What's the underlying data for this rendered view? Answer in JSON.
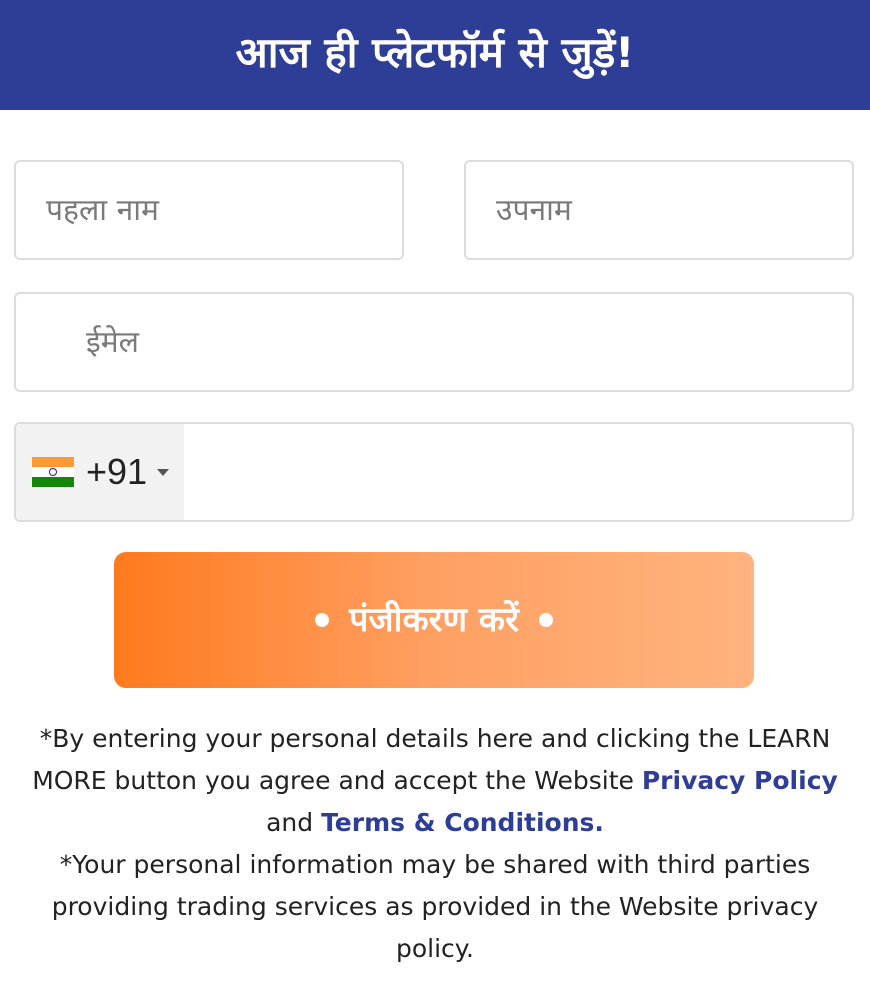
{
  "header": {
    "title": "आज ही प्लेटफॉर्म से जुड़ें!"
  },
  "form": {
    "first_name_placeholder": "पहला नाम",
    "last_name_placeholder": "उपनाम",
    "email_placeholder": "ईमेल",
    "phone": {
      "country_flag": "india-flag-icon",
      "dial_code": "+91",
      "value": ""
    },
    "submit_label": "पंजीकरण करें"
  },
  "legal": {
    "p1_text": "*By entering your personal details here and clicking the LEARN MORE button you agree and accept the Website ",
    "privacy_link": "Privacy Policy",
    "p1_and": " and ",
    "terms_link": "Terms & Conditions.",
    "p2_text": "*Your personal information may be shared with third parties providing trading services as provided in the Website privacy policy."
  },
  "colors": {
    "header_bg": "#2e3e96",
    "button_gradient_start": "#ff7a1e",
    "button_gradient_end": "#ffb37e",
    "link": "#2e3e96",
    "flag_saffron": "#ff9933",
    "flag_white": "#ffffff",
    "flag_green": "#138808"
  }
}
